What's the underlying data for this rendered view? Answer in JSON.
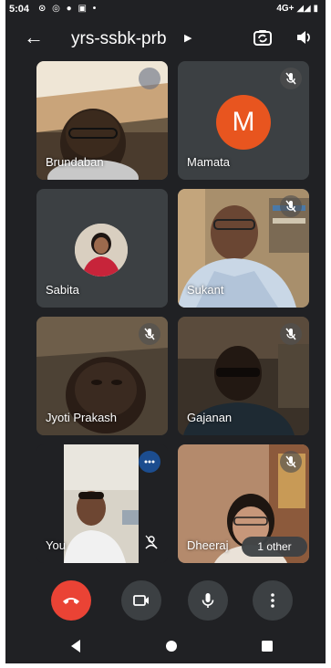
{
  "status_bar": {
    "time": "5:04",
    "network": "4G+"
  },
  "meeting": {
    "title": "yrs-ssbk-prb"
  },
  "participants": [
    {
      "name": "Brundaban",
      "muted": false
    },
    {
      "name": "Mamata",
      "avatar_letter": "M",
      "avatar_color": "#e8551f",
      "muted": true
    },
    {
      "name": "Sabita",
      "muted": false
    },
    {
      "name": "Sukant",
      "muted": true
    },
    {
      "name": "Jyoti Prakash",
      "muted": true
    },
    {
      "name": "Gajanan",
      "muted": true
    },
    {
      "name": "You",
      "muted": false
    },
    {
      "name": "Dheeraj",
      "muted": true
    }
  ],
  "overflow_pill": "1 other",
  "controls": {
    "end_call_color": "#ea4335",
    "buttons": [
      "end-call-icon",
      "camera-icon",
      "mic-icon",
      "more-vert-icon"
    ]
  }
}
